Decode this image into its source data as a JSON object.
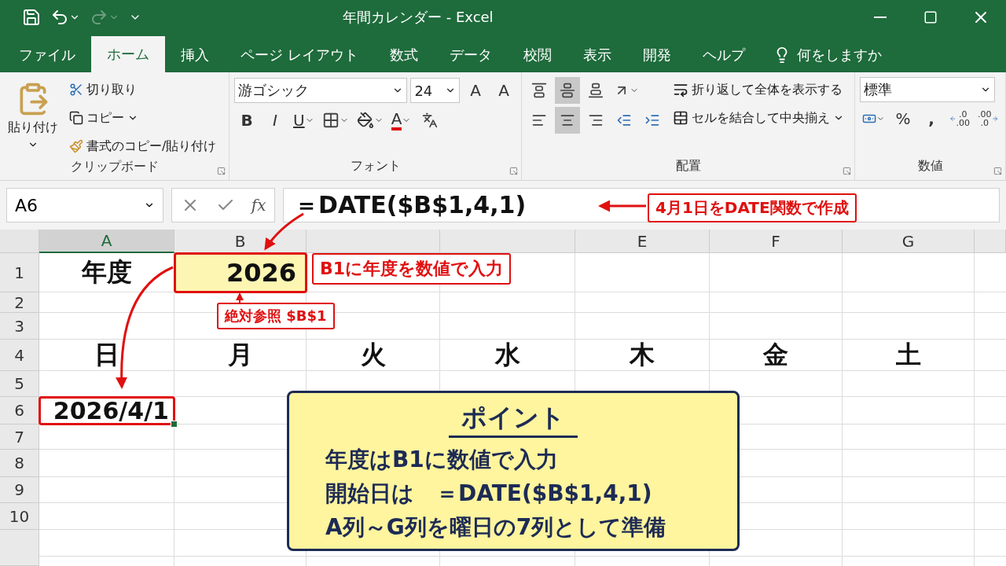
{
  "window": {
    "title": "年間カレンダー - Excel"
  },
  "ribbon_tabs": [
    {
      "label": "ファイル",
      "selected": false
    },
    {
      "label": "ホーム",
      "selected": true
    },
    {
      "label": "挿入",
      "selected": false
    },
    {
      "label": "ページ レイアウト",
      "selected": false
    },
    {
      "label": "数式",
      "selected": false
    },
    {
      "label": "データ",
      "selected": false
    },
    {
      "label": "校閲",
      "selected": false
    },
    {
      "label": "表示",
      "selected": false
    },
    {
      "label": "開発",
      "selected": false
    },
    {
      "label": "ヘルプ",
      "selected": false
    }
  ],
  "tell_me": "何をしますか",
  "clipboard": {
    "paste": "貼り付け",
    "cut": "切り取り",
    "copy": "コピー",
    "format_painter": "書式のコピー/貼り付け",
    "group": "クリップボード"
  },
  "font": {
    "name": "游ゴシック",
    "size": "24",
    "grow": "A",
    "shrink": "A",
    "bold": "B",
    "italic": "I",
    "underline": "U",
    "font_color_button": "A",
    "group": "フォント"
  },
  "alignment": {
    "vertical": [
      {
        "selected": false
      },
      {
        "selected": true
      },
      {
        "selected": false
      }
    ],
    "horizontal": [
      {
        "selected": false
      },
      {
        "selected": true
      },
      {
        "selected": false
      }
    ],
    "wrap": "折り返して全体を表示する",
    "merge": "セルを結合して中央揃え",
    "group": "配置"
  },
  "number": {
    "format": "標準",
    "percent": "%",
    "comma": ",",
    "increase_decimal": [
      ".0",
      ".00"
    ],
    "decrease_decimal": [
      ".00",
      ".0"
    ],
    "group": "数値"
  },
  "formula_bar": {
    "name_box": "A6",
    "fx": "fx",
    "formula": "＝DATE($B$1,4,1)"
  },
  "columns": [
    {
      "kind": "header",
      "label": "A",
      "selected": true
    },
    {
      "kind": "header",
      "label": "B",
      "selected": false
    },
    {
      "kind": "covered",
      "selected": false
    },
    {
      "kind": "covered",
      "selected": false
    },
    {
      "kind": "header",
      "label": "E",
      "selected": false
    },
    {
      "kind": "header",
      "label": "F",
      "selected": false
    },
    {
      "kind": "header",
      "label": "G",
      "selected": false
    }
  ],
  "rows": [
    {
      "label": "1",
      "selected": false,
      "cells": [
        {
          "kind": "text",
          "text": "年度",
          "selected": false,
          "highlighted": false
        },
        {
          "kind": "number",
          "text": "2026",
          "selected": false,
          "highlighted": true
        },
        {
          "kind": "empty"
        },
        {
          "kind": "empty"
        },
        {
          "kind": "empty"
        },
        {
          "kind": "empty"
        },
        {
          "kind": "empty"
        }
      ]
    },
    {
      "label": "2",
      "selected": false
    },
    {
      "label": "3",
      "selected": false
    },
    {
      "label": "4",
      "selected": false,
      "cells": [
        {
          "kind": "text",
          "text": "日",
          "selected": false,
          "highlighted": false
        },
        {
          "kind": "text",
          "text": "月",
          "selected": false,
          "highlighted": false
        },
        {
          "kind": "text",
          "text": "火",
          "selected": false,
          "highlighted": false
        },
        {
          "kind": "text",
          "text": "水",
          "selected": false,
          "highlighted": false
        },
        {
          "kind": "text",
          "text": "木",
          "selected": false,
          "highlighted": false
        },
        {
          "kind": "text",
          "text": "金",
          "selected": false,
          "highlighted": false
        },
        {
          "kind": "text",
          "text": "土",
          "selected": false,
          "highlighted": false
        }
      ]
    },
    {
      "label": "5",
      "selected": false
    },
    {
      "label": "6",
      "selected": false,
      "cells": [
        {
          "kind": "date",
          "text": "2026/4/1",
          "selected": true,
          "highlighted": false
        },
        {
          "kind": "empty"
        },
        {
          "kind": "empty"
        },
        {
          "kind": "empty"
        },
        {
          "kind": "empty"
        },
        {
          "kind": "empty"
        },
        {
          "kind": "empty"
        }
      ]
    },
    {
      "label": "7",
      "selected": false
    },
    {
      "label": "8",
      "selected": false
    },
    {
      "label": "9",
      "selected": false
    },
    {
      "label": "10",
      "selected": false
    }
  ],
  "callouts": {
    "formula": "4月1日をDATE関数で作成",
    "input": "B1に年度を数値で入力",
    "absolute": "絶対参照 $B$1"
  },
  "point": {
    "title": "ポイント",
    "lines": [
      "年度はB1に数値で入力",
      "開始日は　＝DATE($B$1,4,1)",
      "A列～G列を曜日の7列として準備"
    ]
  }
}
